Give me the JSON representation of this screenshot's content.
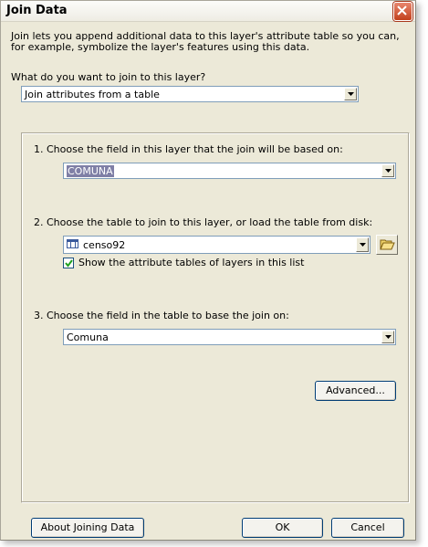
{
  "window": {
    "title": "Join Data"
  },
  "description": "Join lets you append additional data to this layer's attribute table so you can, for example, symbolize the layer's features using this data.",
  "join_type": {
    "question": "What do you want to join to this layer?",
    "selected": "Join attributes from a table"
  },
  "step1": {
    "label": "1.  Choose the field in this layer that the join will be based on:",
    "selected": "COMUNA"
  },
  "step2": {
    "label": "2.  Choose the table to join to this layer, or load the table from disk:",
    "selected": "censo92",
    "checkbox_label": "Show the attribute tables of layers in this list",
    "checkbox_checked": true
  },
  "step3": {
    "label": "3.  Choose the field in the table to base the join on:",
    "selected": "Comuna"
  },
  "buttons": {
    "advanced": "Advanced...",
    "about": "About Joining Data",
    "ok": "OK",
    "cancel": "Cancel"
  },
  "colors": {
    "dialog_bg": "#ece9d8",
    "close_red": "#c2401c",
    "selection": "#7f7fa6"
  }
}
